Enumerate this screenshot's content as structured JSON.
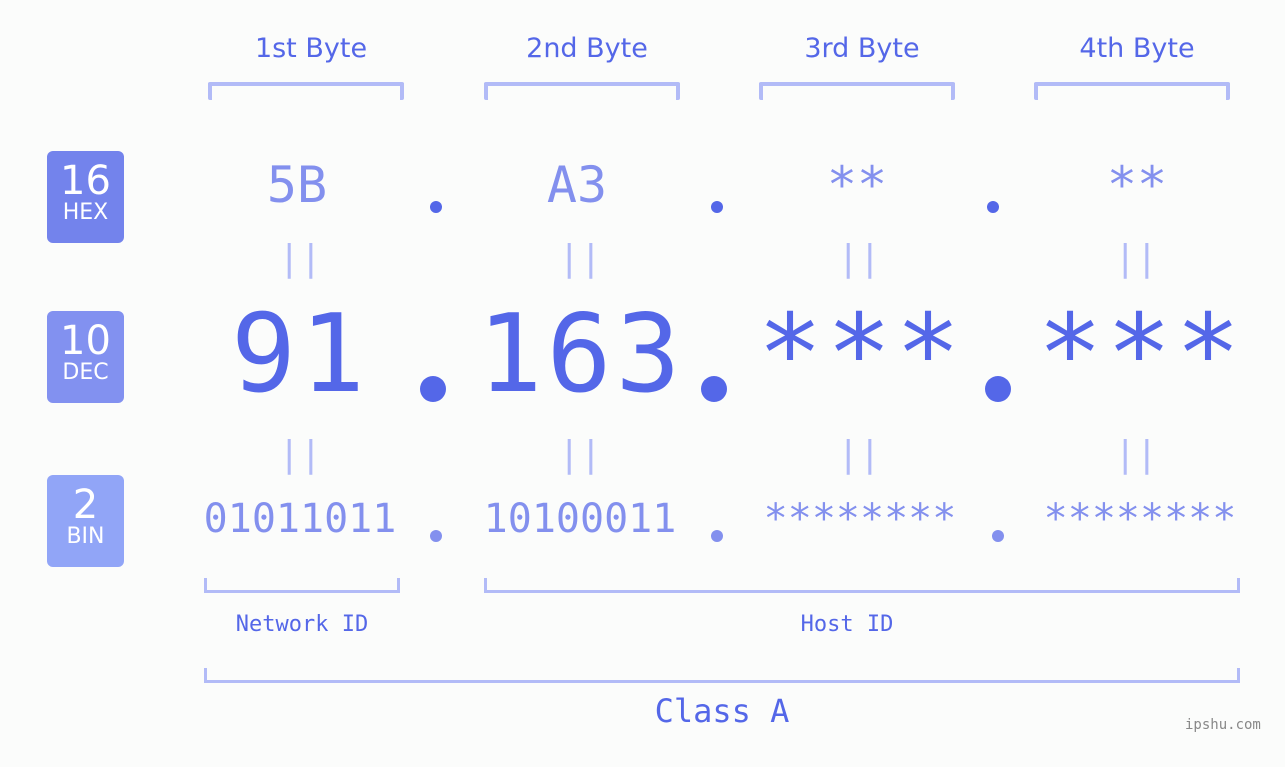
{
  "bytes": [
    {
      "header": "1st Byte",
      "hex": "5B",
      "dec": "91",
      "bin": "01011011"
    },
    {
      "header": "2nd Byte",
      "hex": "A3",
      "dec": "163",
      "bin": "10100011"
    },
    {
      "header": "3rd Byte",
      "hex": "**",
      "dec": "***",
      "bin": "********"
    },
    {
      "header": "4th Byte",
      "hex": "**",
      "dec": "***",
      "bin": "********"
    }
  ],
  "badges": {
    "hex": {
      "num": "16",
      "label": "HEX",
      "color": "#7383ec"
    },
    "dec": {
      "num": "10",
      "label": "DEC",
      "color": "#8291f0"
    },
    "bin": {
      "num": "2",
      "label": "BIN",
      "color": "#91a5f7"
    }
  },
  "equals_sign": "||",
  "network_label": "Network ID",
  "host_label": "Host ID",
  "class_label": "Class A",
  "watermark": "ipshu.com"
}
